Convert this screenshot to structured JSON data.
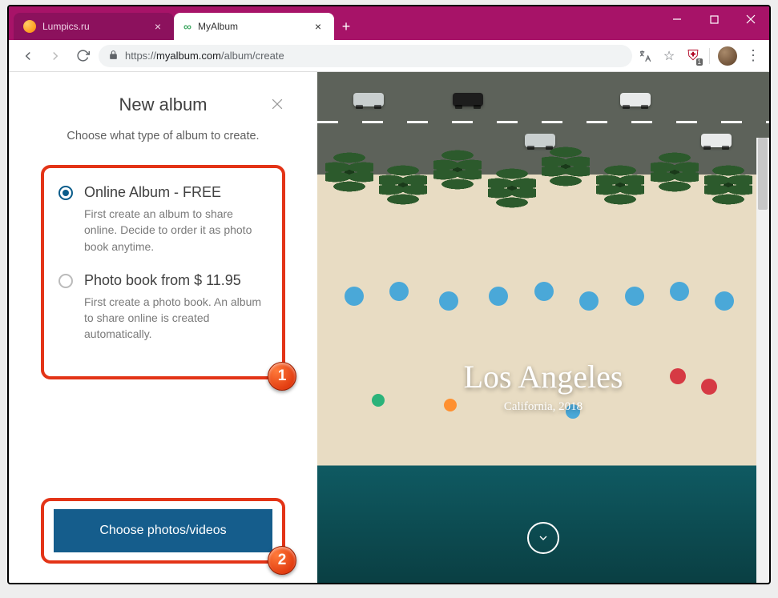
{
  "window": {
    "tabs": [
      {
        "title": "Lumpics.ru",
        "active": false
      },
      {
        "title": "MyAlbum",
        "active": true
      }
    ]
  },
  "address": {
    "scheme": "https://",
    "host": "myalbum.com",
    "path": "/album/create"
  },
  "ext": {
    "ublock_count": "1"
  },
  "sidebar": {
    "title": "New album",
    "subtitle": "Choose what type of album to create.",
    "options": [
      {
        "title": "Online Album - FREE",
        "desc": "First create an album to share online. Decide to order it as photo book anytime.",
        "selected": true
      },
      {
        "title": "Photo book from $ 11.95",
        "desc": "First create a photo book. An album to share online is created automatically.",
        "selected": false
      }
    ],
    "cta": "Choose photos/videos"
  },
  "preview": {
    "title": "Los Angeles",
    "subtitle": "California, 2018"
  },
  "annotations": {
    "badge1": "1",
    "badge2": "2"
  }
}
